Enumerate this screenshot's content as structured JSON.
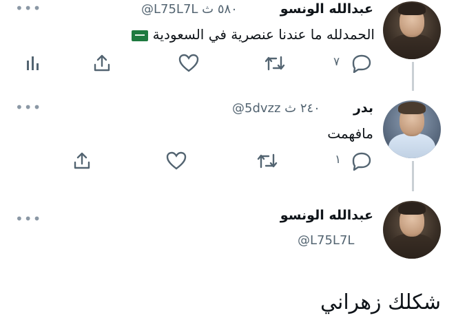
{
  "tweet1": {
    "name": "عبدالله الونسو",
    "handle_time": "@L75L7L ٥٨٠ ث",
    "text": "الحمدلله ما عندنا عنصرية في السعودية",
    "replies": "٧",
    "more": "•••",
    "flag": "saudi-flag-emoji"
  },
  "tweet2": {
    "name": "بدر",
    "handle_time": "@5dvzz ٢٤٠ ث",
    "text": "مافهمت",
    "replies": "١",
    "more": "•••"
  },
  "tweet3": {
    "name": "عبدالله الونسو",
    "handle": "@L75L7L",
    "text": "شكلك زهراني",
    "more": "•••"
  },
  "colors": {
    "text": "#0f1419",
    "muted": "#536471",
    "thread": "#c9cfd4"
  },
  "icons": [
    "reply-icon",
    "retweet-icon",
    "like-icon",
    "share-icon",
    "analytics-icon"
  ]
}
